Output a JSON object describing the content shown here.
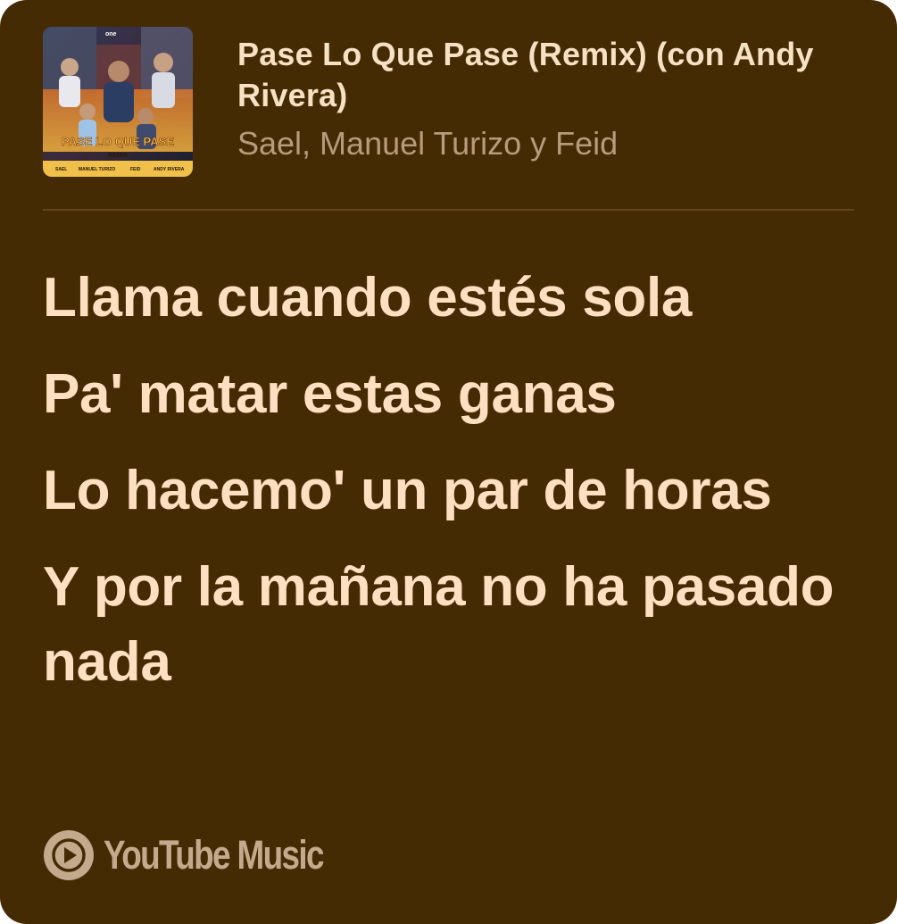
{
  "song": {
    "title": "Pase Lo Que Pase (Remix) (con Andy Rivera)",
    "artists": "Sael, Manuel Turizo y Feid"
  },
  "cover": {
    "top_badge": "one",
    "title": "PASE LO QUE PASE",
    "subtitle": "REMIX",
    "credits": [
      "SAEL",
      "MANUEL TURIZO",
      "FEID",
      "ANDY RIVERA"
    ]
  },
  "lyrics": {
    "lines": [
      "Llama cuando estés sola",
      "Pa' matar estas ganas",
      "Lo hacemo' un par de horas",
      "Y por la mañana no ha pasado nada"
    ]
  },
  "brand": {
    "name": "YouTube Music",
    "icon": "youtube-music-icon"
  },
  "colors": {
    "background": "#452b04",
    "title_text": "#f7e1c5",
    "artist_text": "#b69b7c",
    "lyrics_text": "#fde0c1",
    "brand_text": "#c4aa8c"
  }
}
